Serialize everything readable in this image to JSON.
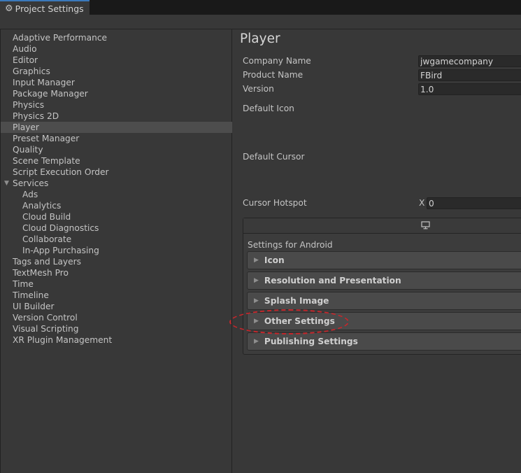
{
  "window": {
    "tab_title": "Project Settings",
    "tab_icon": "gear-icon"
  },
  "sidebar": {
    "items": [
      {
        "label": "Adaptive Performance"
      },
      {
        "label": "Audio"
      },
      {
        "label": "Editor"
      },
      {
        "label": "Graphics"
      },
      {
        "label": "Input Manager"
      },
      {
        "label": "Package Manager"
      },
      {
        "label": "Physics"
      },
      {
        "label": "Physics 2D"
      },
      {
        "label": "Player",
        "selected": true
      },
      {
        "label": "Preset Manager"
      },
      {
        "label": "Quality"
      },
      {
        "label": "Scene Template"
      },
      {
        "label": "Script Execution Order"
      },
      {
        "label": "Services",
        "expanded": true
      },
      {
        "label": "Ads",
        "child": true
      },
      {
        "label": "Analytics",
        "child": true
      },
      {
        "label": "Cloud Build",
        "child": true
      },
      {
        "label": "Cloud Diagnostics",
        "child": true
      },
      {
        "label": "Collaborate",
        "child": true
      },
      {
        "label": "In-App Purchasing",
        "child": true
      },
      {
        "label": "Tags and Layers"
      },
      {
        "label": "TextMesh Pro"
      },
      {
        "label": "Time"
      },
      {
        "label": "Timeline"
      },
      {
        "label": "UI Builder"
      },
      {
        "label": "Version Control"
      },
      {
        "label": "Visual Scripting"
      },
      {
        "label": "XR Plugin Management"
      }
    ]
  },
  "player": {
    "title": "Player",
    "company_name_label": "Company Name",
    "company_name_value": "jwgamecompany",
    "product_name_label": "Product Name",
    "product_name_value": "FBird",
    "version_label": "Version",
    "version_value": "1.0",
    "default_icon_label": "Default Icon",
    "default_cursor_label": "Default Cursor",
    "cursor_hotspot_label": "Cursor Hotspot",
    "cursor_hotspot_x_label": "X",
    "cursor_hotspot_x_value": "0"
  },
  "platform": {
    "tab_icon": "monitor-icon",
    "settings_for": "Settings for Android",
    "sections": [
      {
        "label": "Icon"
      },
      {
        "label": "Resolution and Presentation"
      },
      {
        "label": "Splash Image"
      },
      {
        "label": "Other Settings",
        "highlighted": true
      },
      {
        "label": "Publishing Settings"
      }
    ]
  },
  "colors": {
    "background": "#383838",
    "selected_row": "#4d4d4d",
    "highlight_annotation": "#c8262b",
    "tab_accent": "#3a79bb"
  }
}
